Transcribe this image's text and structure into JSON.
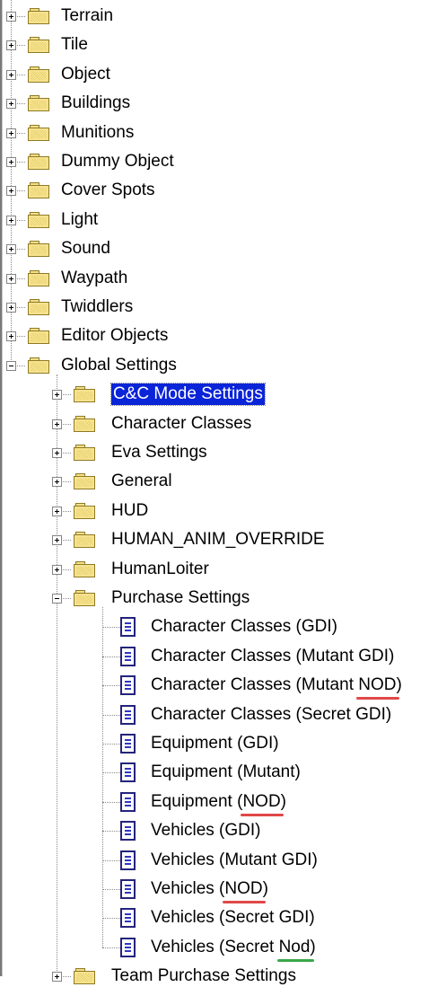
{
  "tree": {
    "top_level": [
      {
        "label": "Terrain",
        "expander": "plus"
      },
      {
        "label": "Tile",
        "expander": "plus"
      },
      {
        "label": "Object",
        "expander": "plus"
      },
      {
        "label": "Buildings",
        "expander": "plus"
      },
      {
        "label": "Munitions",
        "expander": "plus"
      },
      {
        "label": "Dummy Object",
        "expander": "plus"
      },
      {
        "label": "Cover Spots",
        "expander": "plus"
      },
      {
        "label": "Light",
        "expander": "plus"
      },
      {
        "label": "Sound",
        "expander": "plus"
      },
      {
        "label": "Waypath",
        "expander": "plus"
      },
      {
        "label": "Twiddlers",
        "expander": "plus"
      },
      {
        "label": "Editor Objects",
        "expander": "plus"
      },
      {
        "label": "Global Settings",
        "expander": "minus"
      }
    ],
    "global_settings_children": [
      {
        "label": "C&C Mode Settings",
        "expander": "plus",
        "selected": true
      },
      {
        "label": "Character Classes",
        "expander": "plus"
      },
      {
        "label": "Eva Settings",
        "expander": "plus"
      },
      {
        "label": "General",
        "expander": "plus"
      },
      {
        "label": "HUD",
        "expander": "plus"
      },
      {
        "label": "HUMAN_ANIM_OVERRIDE",
        "expander": "plus"
      },
      {
        "label": "HumanLoiter",
        "expander": "plus"
      },
      {
        "label": "Purchase Settings",
        "expander": "minus"
      }
    ],
    "purchase_settings_children": [
      {
        "label": "Character Classes (GDI)"
      },
      {
        "label": "Character Classes (Mutant GDI)"
      },
      {
        "label": "Character Classes (Mutant NOD)",
        "mark": "NOD",
        "mark_color": "#e04848"
      },
      {
        "label": "Character Classes (Secret GDI)"
      },
      {
        "label": "Equipment (GDI)"
      },
      {
        "label": "Equipment (Mutant)"
      },
      {
        "label": "Equipment (NOD)",
        "mark": "NOD",
        "mark_color": "#e04848"
      },
      {
        "label": "Vehicles (GDI)"
      },
      {
        "label": "Vehicles (Mutant GDI)"
      },
      {
        "label": "Vehicles (NOD)",
        "mark": "NOD",
        "mark_color": "#e04848"
      },
      {
        "label": "Vehicles (Secret GDI)"
      },
      {
        "label": "Vehicles (Secret Nod)",
        "mark": "Nod",
        "mark_color": "#3aa84a"
      }
    ],
    "after": [
      {
        "label": "Team Purchase Settings",
        "expander": "plus"
      }
    ]
  }
}
